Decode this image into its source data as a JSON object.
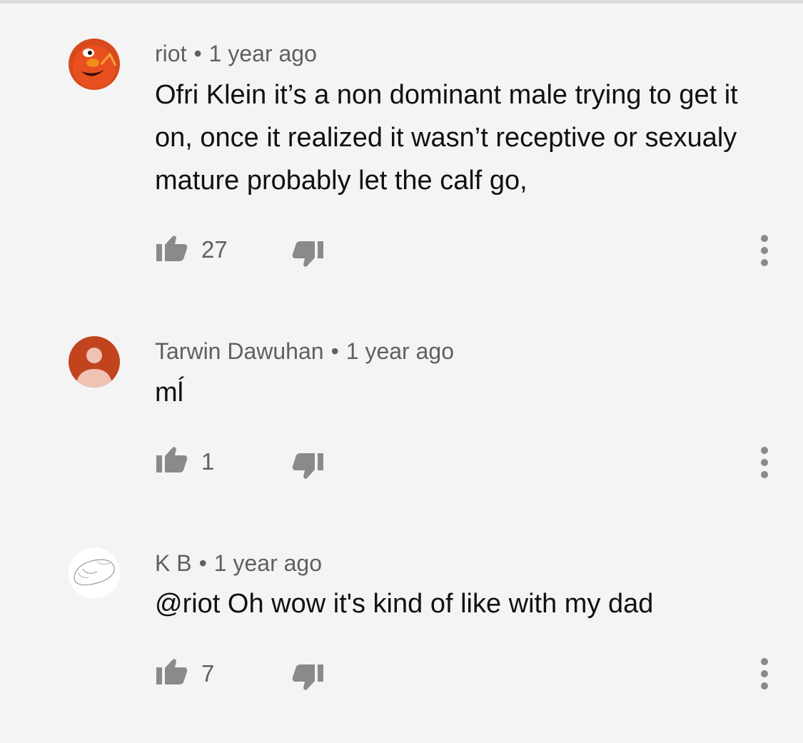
{
  "comments": [
    {
      "author": "riot",
      "separator": "•",
      "time": "1 year ago",
      "text": "Ofri Klein it’s a non dominant male trying to get it on, once it realized it wasn’t receptive or sexualy mature probably let the calf go,",
      "likes": "27",
      "avatar": "elmo-avatar",
      "avatar_color": "#e8511f"
    },
    {
      "author": "Tarwin Dawuhan",
      "separator": "•",
      "time": "1 year ago",
      "text": "mĺ",
      "likes": "1",
      "avatar": "default-person-avatar",
      "avatar_color": "#c1441f"
    },
    {
      "author": "K B",
      "separator": "•",
      "time": "1 year ago",
      "text": "@riot Oh wow it's kind of like with my dad",
      "likes": "7",
      "avatar": "mouse-sketch-avatar",
      "avatar_color": "#ffffff"
    }
  ],
  "icons": {
    "like": "thumbs-up-icon",
    "dislike": "thumbs-down-icon",
    "more": "more-vertical-icon"
  },
  "colors": {
    "background": "#f4f4f4",
    "meta_text": "#606060",
    "icon_gray": "#8a8a8a"
  }
}
